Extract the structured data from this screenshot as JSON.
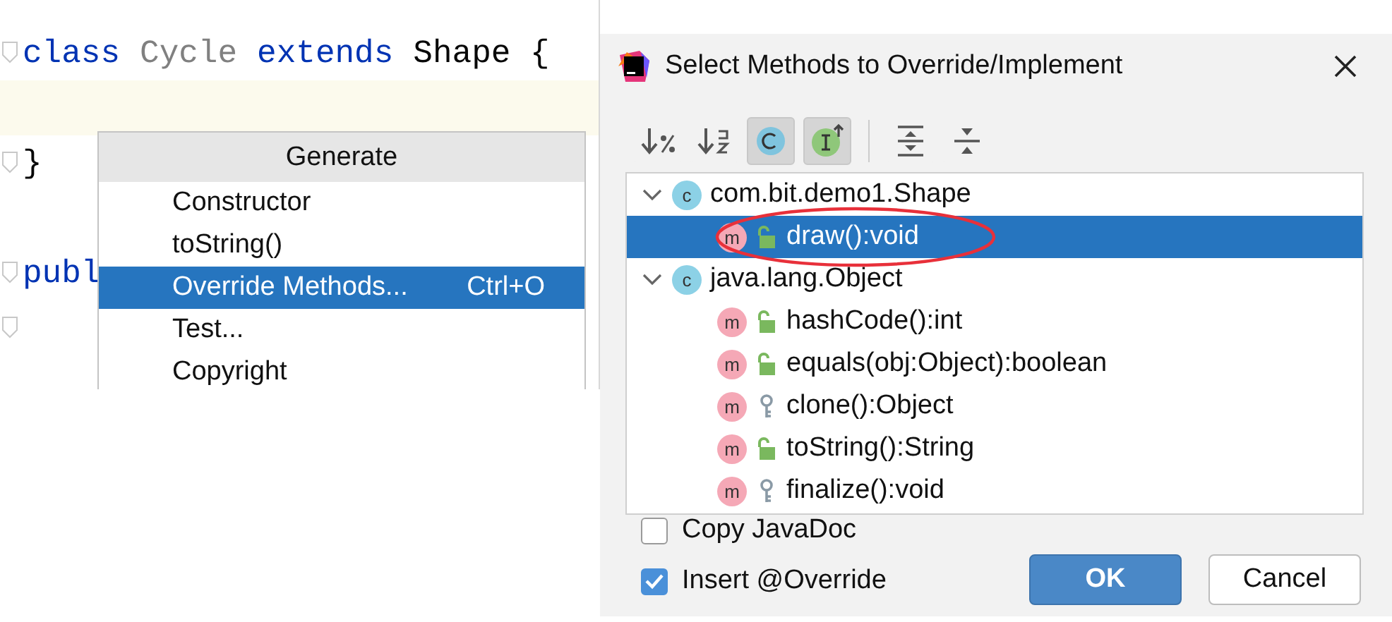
{
  "editor": {
    "lines": [
      {
        "fold": true,
        "current": false,
        "tokens": [
          {
            "text": "class",
            "kind": "keyword"
          },
          {
            "text": "Cycle",
            "kind": "unused"
          },
          {
            "text": "extends",
            "kind": "keyword"
          },
          {
            "text": "Shape {",
            "kind": "plain"
          }
        ]
      },
      {
        "fold": false,
        "current": true
      },
      {
        "fold": true,
        "current": false,
        "tokens": [
          {
            "text": "}",
            "kind": "plain"
          }
        ]
      },
      {
        "fold": false,
        "current": false
      },
      {
        "fold": true,
        "current": false,
        "tokens": [
          {
            "text": "publ",
            "kind": "keyword"
          }
        ]
      },
      {
        "fold": true,
        "current": false
      }
    ]
  },
  "generate_menu": {
    "title": "Generate",
    "items": [
      {
        "label": "Constructor",
        "selected": false
      },
      {
        "label": "toString()",
        "selected": false
      },
      {
        "label": "Override Methods...",
        "shortcut": "Ctrl+O",
        "selected": true
      },
      {
        "label": "Test...",
        "selected": false
      },
      {
        "label": "Copyright",
        "selected": false
      }
    ]
  },
  "dialog": {
    "title": "Select Methods to Override/Implement",
    "toolbar": [
      {
        "kind": "sort-visibility",
        "pressed": false
      },
      {
        "kind": "sort-alpha",
        "pressed": false
      },
      {
        "kind": "show-classes",
        "pressed": true
      },
      {
        "kind": "show-interfaces",
        "pressed": true
      },
      {
        "kind": "separator"
      },
      {
        "kind": "expand-all",
        "pressed": false
      },
      {
        "kind": "collapse-all",
        "pressed": false
      }
    ],
    "tree": [
      {
        "badge": "c",
        "label": "com.bit.demo1.Shape",
        "expanded": true,
        "children": [
          {
            "badge": "m",
            "kind": "public",
            "label": "draw():void",
            "selected": true,
            "circled": true
          }
        ]
      },
      {
        "badge": "c",
        "label": "java.lang.Object",
        "expanded": true,
        "children": [
          {
            "badge": "m",
            "kind": "public",
            "label": "hashCode():int",
            "selected": false,
            "circled": false
          },
          {
            "badge": "m",
            "kind": "public",
            "label": "equals(obj:Object):boolean",
            "selected": false,
            "circled": false
          },
          {
            "badge": "m",
            "kind": "protected",
            "label": "clone():Object",
            "selected": false,
            "circled": false
          },
          {
            "badge": "m",
            "kind": "public",
            "label": "toString():String",
            "selected": false,
            "circled": false
          },
          {
            "badge": "m",
            "kind": "protected",
            "label": "finalize():void",
            "selected": false,
            "circled": false
          }
        ]
      }
    ],
    "options": [
      {
        "label": "Copy JavaDoc",
        "checked": false
      },
      {
        "label": "Insert @Override",
        "checked": true
      }
    ],
    "buttons": [
      {
        "label": "OK",
        "kind": "primary"
      },
      {
        "label": "Cancel",
        "kind": "secondary"
      }
    ]
  }
}
